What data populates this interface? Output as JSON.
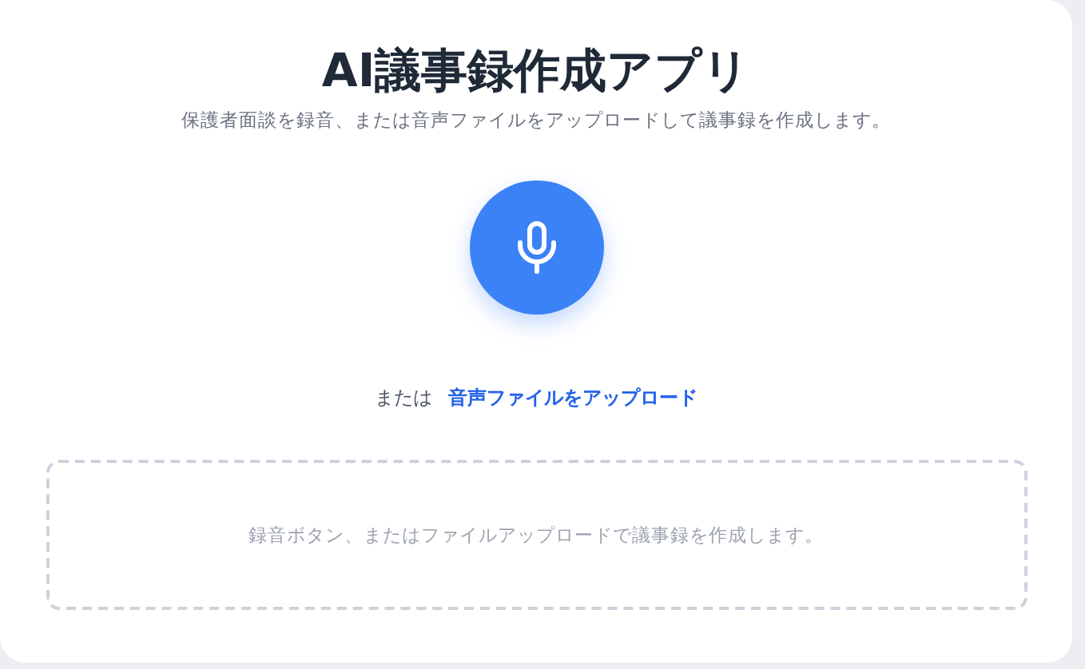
{
  "header": {
    "title": "AI議事録作成アプリ",
    "subtitle": "保護者面談を録音、または音声ファイルをアップロードして議事録を作成します。"
  },
  "upload": {
    "prefix": "または",
    "link": "音声ファイルをアップロード"
  },
  "result_area": {
    "message": "録音ボタン、またはファイルアップロードで議事録を作成します。"
  }
}
